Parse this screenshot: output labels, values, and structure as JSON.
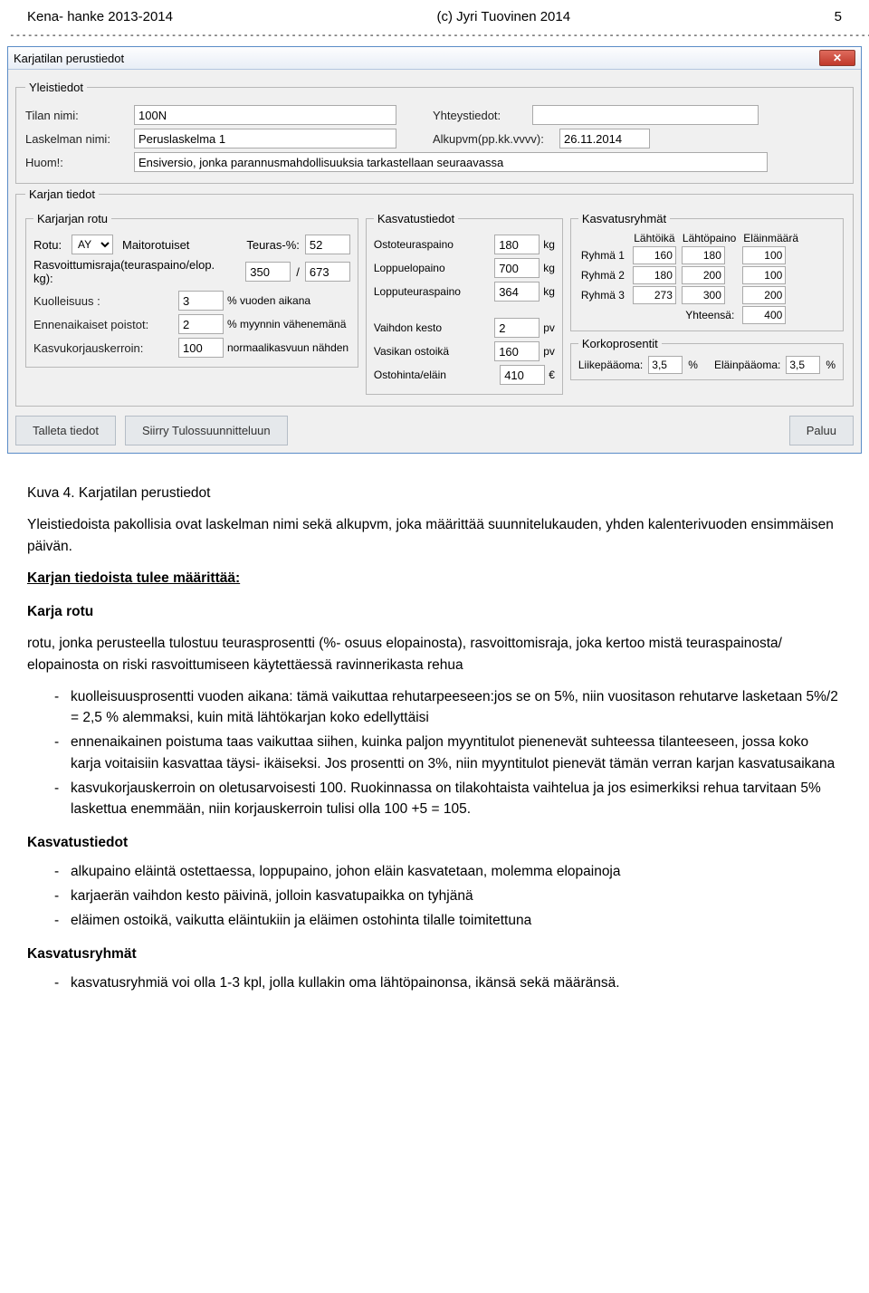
{
  "header": {
    "left": "Kena- hanke 2013-2014",
    "center": "(c) Jyri Tuovinen 2014",
    "page_number": "5"
  },
  "window": {
    "title": "Karjatilan perustiedot"
  },
  "yleistiedot": {
    "legend": "Yleistiedot",
    "tilan_nimi_label": "Tilan nimi:",
    "tilan_nimi": "100N",
    "yhteystiedot_label": "Yhteystiedot:",
    "yhteystiedot": "",
    "laskelman_nimi_label": "Laskelman nimi:",
    "laskelman_nimi": "Peruslaskelma 1",
    "alkupvm_label": "Alkupvm(pp.kk.vvvv):",
    "alkupvm": "26.11.2014",
    "huom_label": "Huom!:",
    "huom": "Ensiversio, jonka parannusmahdollisuuksia tarkastellaan seuraavassa"
  },
  "karjan_tiedot": {
    "legend": "Karjan tiedot",
    "karjarjan_rotu": {
      "legend": "Karjarjan rotu",
      "rotu_label": "Rotu:",
      "rotu": "AY",
      "rotu_text": "Maitorotuiset",
      "teuras_pct_label": "Teuras-%:",
      "teuras_pct": "52",
      "rasvoitt_label": "Rasvoittumisraja(teuraspaino/elop. kg):",
      "rasvoitt_a": "350",
      "rasvoitt_b": "673",
      "kuolleisuus_label": "Kuolleisuus :",
      "kuolleisuus": "3",
      "kuolleisuus_unit": "% vuoden aikana",
      "enn_label": "Ennenaikaiset poistot:",
      "enn": "2",
      "enn_unit": "% myynnin vähenemänä",
      "kasv_label": "Kasvukorjauskerroin:",
      "kasv": "100",
      "kasv_unit": "normaalikasvuun nähden"
    },
    "kasvatustiedot": {
      "legend": "Kasvatustiedot",
      "ostoteuraspaino_label": "Ostoteuraspaino",
      "ostoteuraspaino": "180",
      "loppuelopaino_label": "Loppuelopaino",
      "loppuelopaino": "700",
      "lopputeuraspaino_label": "Lopputeuraspaino",
      "lopputeuraspaino": "364",
      "kg_unit": "kg",
      "vaihdon_kesto_label": "Vaihdon kesto",
      "vaihdon_kesto": "2",
      "pv_unit": "pv",
      "vasikan_ostoika_label": "Vasikan ostoikä",
      "vasikan_ostoika": "160",
      "ostohinta_label": "Ostohinta/eläin",
      "ostohinta": "410",
      "eur_unit": "€"
    },
    "kasvatusryhmat": {
      "legend": "Kasvatusryhmät",
      "col1": "Lähtöikä",
      "col2": "Lähtöpaino",
      "col3": "Eläinmäärä",
      "rows": [
        {
          "label": "Ryhmä 1",
          "a": "160",
          "b": "180",
          "c": "100"
        },
        {
          "label": "Ryhmä 2",
          "a": "180",
          "b": "200",
          "c": "100"
        },
        {
          "label": "Ryhmä 3",
          "a": "273",
          "b": "300",
          "c": "200"
        }
      ],
      "yhteensa_label": "Yhteensä:",
      "yhteensa": "400"
    },
    "korkoprosentit": {
      "legend": "Korkoprosentit",
      "liikepaoma_label": "Liikepääoma:",
      "liikepaoma": "3,5",
      "pct": "%",
      "elainpaoma_label": "Eläinpääoma:",
      "elainpaoma": "3,5"
    }
  },
  "buttons": {
    "talleta": "Talleta tiedot",
    "siirry": "Siirry Tulossuunnitteluun",
    "paluu": "Paluu"
  },
  "content": {
    "caption": "Kuva 4. Karjatilan perustiedot",
    "p1": "Yleistiedoista pakollisia ovat laskelman nimi sekä alkupvm, joka määrittää suunnitelukauden, yhden kalenterivuoden ensimmäisen päivän.",
    "h1": "Karjan tiedoista tulee määrittää:",
    "h2": "Karja rotu",
    "p2": "rotu, jonka perusteella tulostuu teurasprosentti (%- osuus elopainosta), rasvoittomisraja, joka kertoo mistä teuraspainosta/ elopainosta on riski rasvoittumiseen käytettäessä ravinnerikasta rehua",
    "bullets1": [
      "kuolleisuusprosentti vuoden aikana: tämä vaikuttaa rehutarpeeseen:jos se on 5%, niin vuositason rehutarve lasketaan 5%/2 = 2,5 % alemmaksi, kuin mitä lähtökarjan koko edellyttäisi",
      "ennenaikainen poistuma taas vaikuttaa siihen, kuinka paljon myyntitulot pienenevät suhteessa tilanteeseen, jossa koko karja voitaisiin kasvattaa täysi- ikäiseksi. Jos prosentti on 3%, niin myyntitulot pienevät tämän verran karjan kasvatusaikana",
      "kasvukorjauskerroin on oletusarvoisesti 100. Ruokinnassa on tilakohtaista vaihtelua ja jos esimerkiksi rehua tarvitaan 5% laskettua enemmään, niin korjauskerroin tulisi olla 100 +5 = 105."
    ],
    "h3": "Kasvatustiedot",
    "bullets2": [
      "alkupaino eläintä ostettaessa, loppupaino, johon eläin kasvatetaan, molemma elopainoja",
      "karjaerän vaihdon kesto päivinä, jolloin kasvatupaikka on tyhjänä",
      "eläimen ostoikä, vaikutta eläintukiin ja eläimen ostohinta tilalle toimitettuna"
    ],
    "h4": "Kasvatusryhmät",
    "bullets3": [
      "kasvatusryhmiä voi olla 1-3 kpl, jolla kullakin oma lähtöpainonsa, ikänsä sekä määränsä."
    ]
  }
}
